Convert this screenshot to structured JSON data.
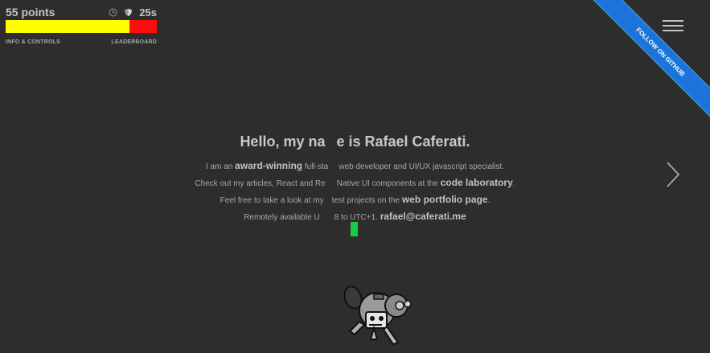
{
  "hud": {
    "points": "55 points",
    "timer": "25s",
    "progress_fraction": 0.82,
    "info_link": "INFO & CONTROLS",
    "leaderboard_link": "LEADERBOARD"
  },
  "ribbon": {
    "label": "FOLLOW ON GITHUB"
  },
  "intro": {
    "title_a": "Hello, my na",
    "title_b": "e is Rafael Caferati.",
    "l1_a": "I am an ",
    "l1_b": "award-winning",
    "l1_c": " full-sta",
    "l1_d": "web developer and UI/UX javascript specialist.",
    "l2_a": "Check out my articles, React and Re",
    "l2_b": "Native UI components at the ",
    "l2_c": "code laboratory",
    "l2_d": ".",
    "l3_a": "Feel free to take a look at my",
    "l3_b": "test projects on the ",
    "l3_c": "web portfolio page",
    "l3_d": ".",
    "l4_a": "Remotely available U",
    "l4_b": "8 to UTC+1. ",
    "l4_c": "rafael@caferati.me"
  },
  "colors": {
    "background": "#2d2d2d",
    "bar_fill": "#ffff00",
    "bar_empty": "#ff0d0d",
    "ribbon": "#1b74d8",
    "paddle": "#19c94a"
  },
  "icons": [
    "clock-icon",
    "shield-icon",
    "hamburger-menu-icon",
    "chevron-right-icon"
  ]
}
